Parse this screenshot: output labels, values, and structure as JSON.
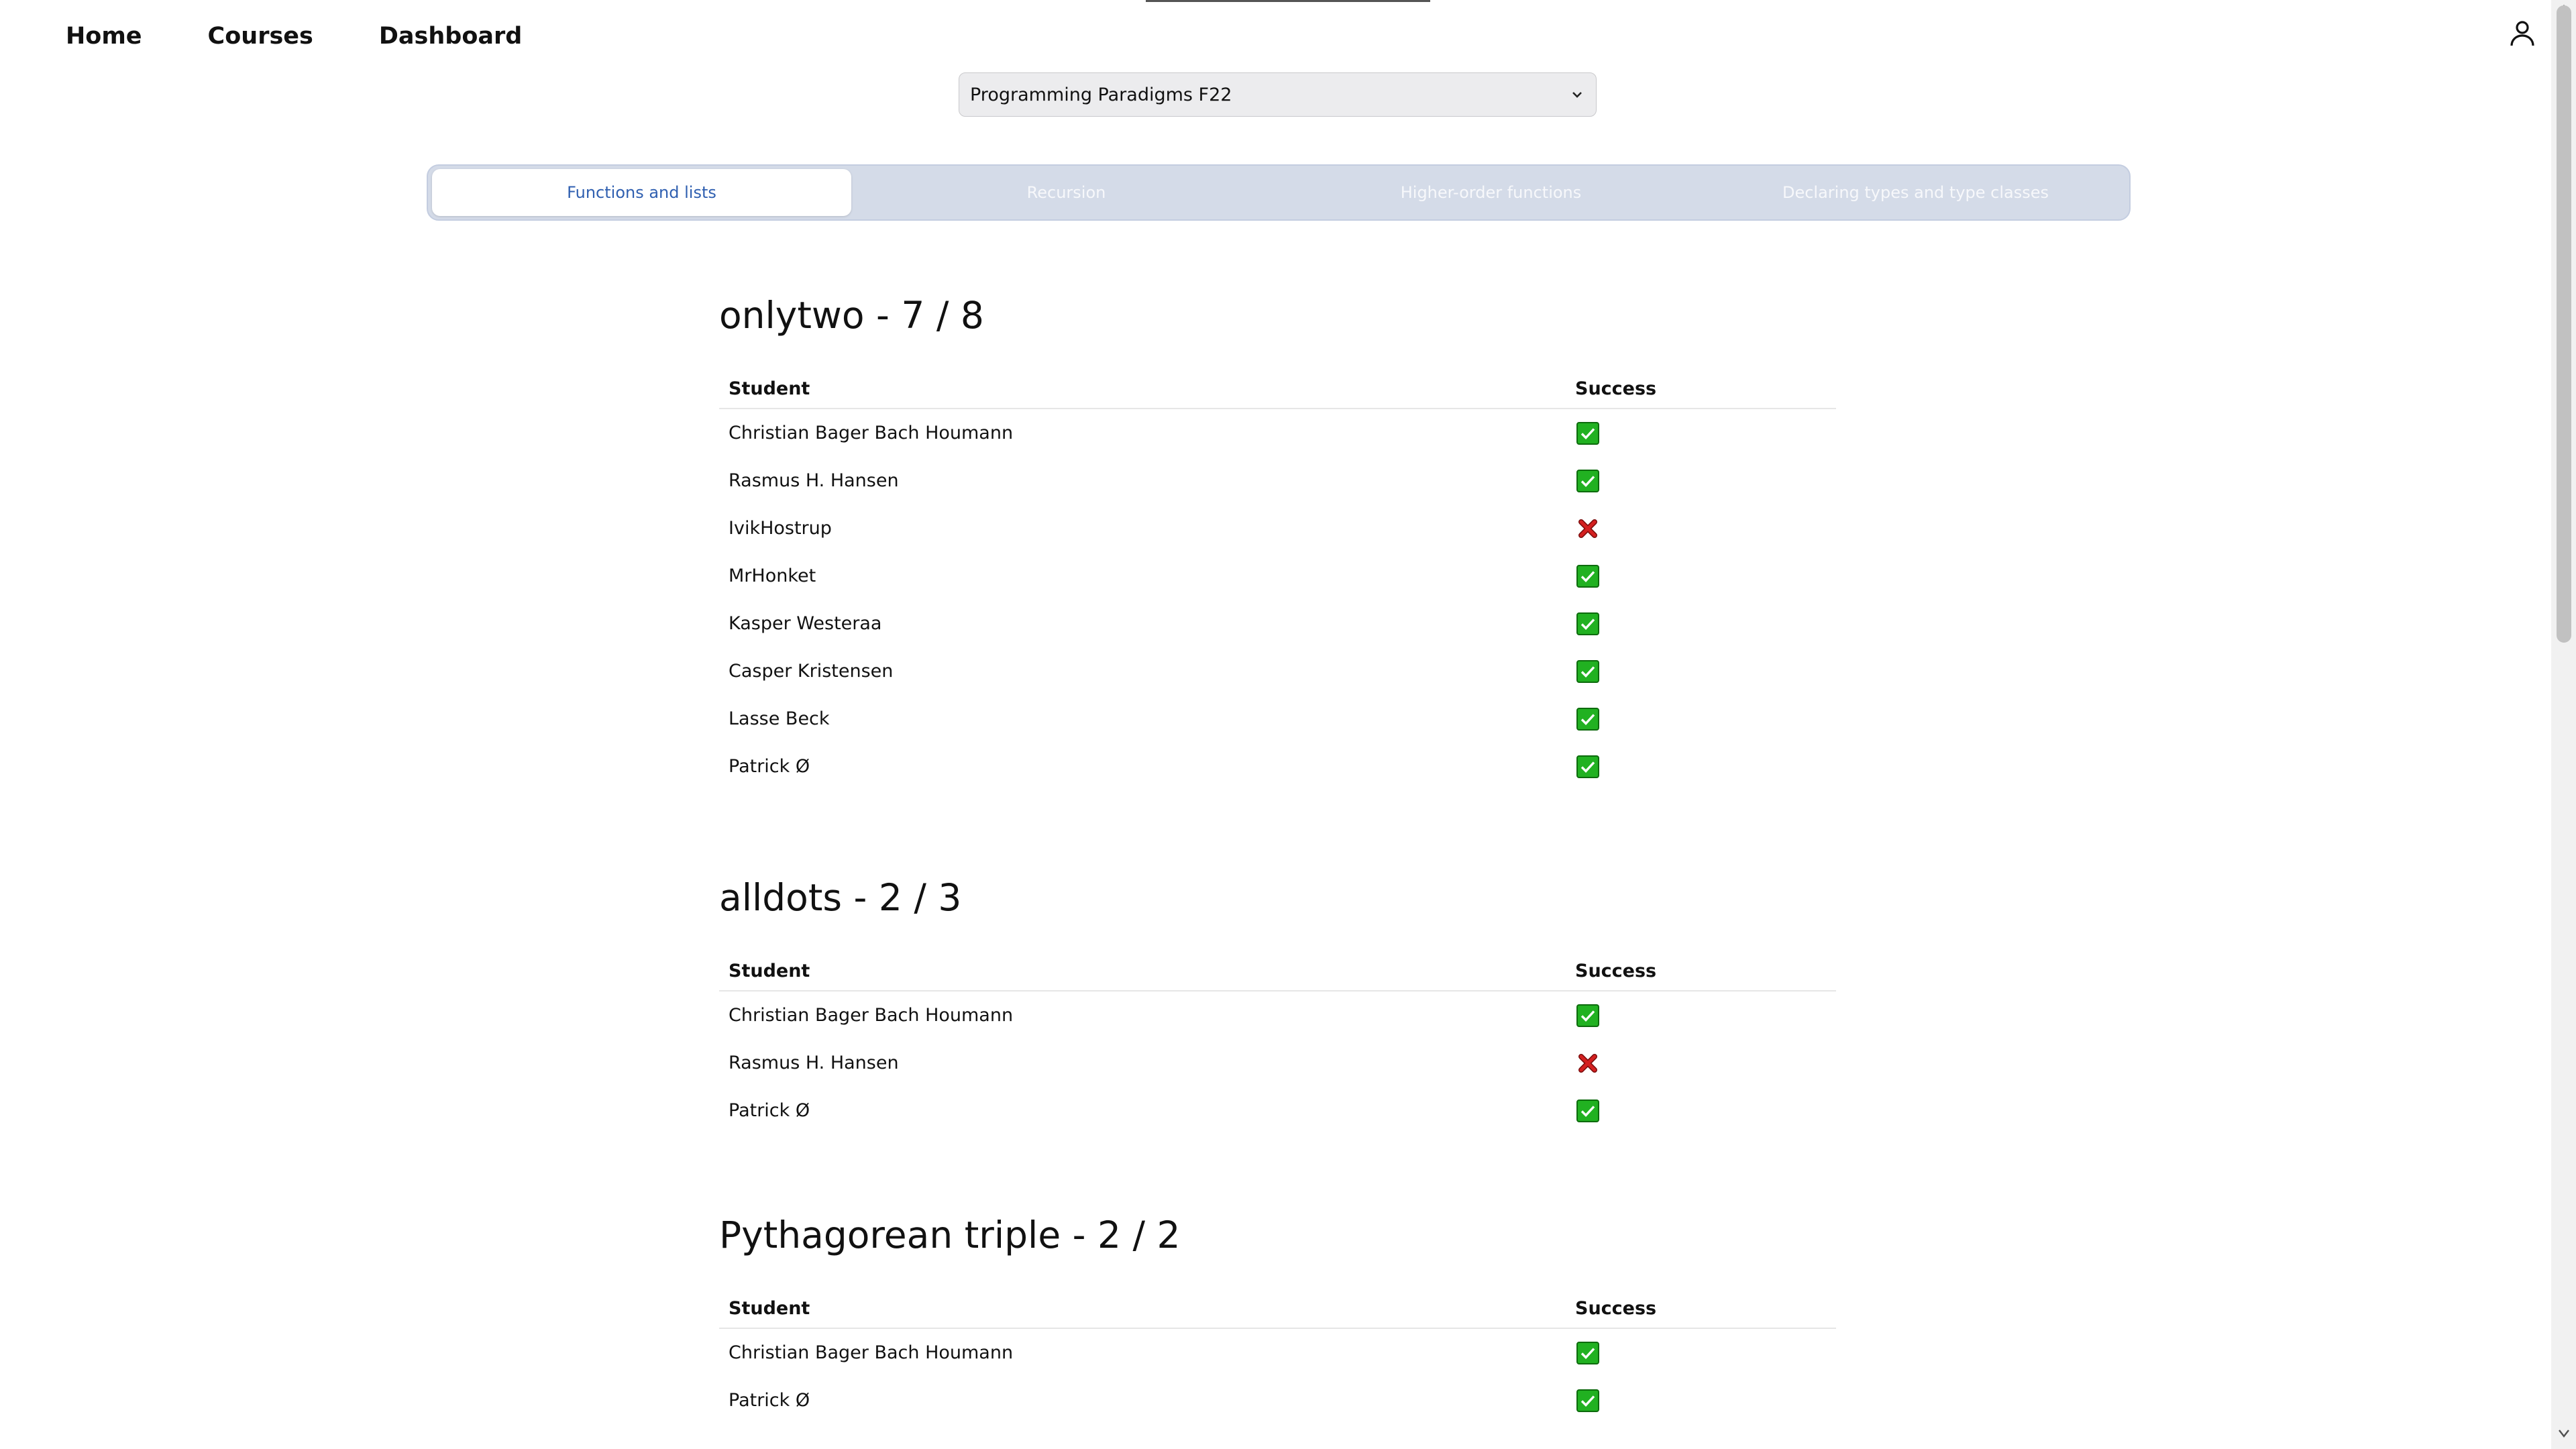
{
  "nav": {
    "home": "Home",
    "courses": "Courses",
    "dashboard": "Dashboard"
  },
  "icons": {
    "user": "user-icon",
    "success": "check-icon",
    "fail": "cross-icon"
  },
  "colors": {
    "success": "#21b121",
    "fail": "#d42020",
    "active_tab_text": "#2f5fb0",
    "tab_bar": "#d4dbe8"
  },
  "course_select": {
    "value": "Programming Paradigms F22"
  },
  "tabs": [
    {
      "label": "Functions and lists",
      "active": true
    },
    {
      "label": "Recursion",
      "active": false
    },
    {
      "label": "Higher-order functions",
      "active": false
    },
    {
      "label": "Declaring types and type classes",
      "active": false
    }
  ],
  "table_headers": {
    "student": "Student",
    "success": "Success"
  },
  "sections": [
    {
      "title": "onlytwo - 7 / 8",
      "rows": [
        {
          "student": "Christian Bager Bach Houmann",
          "success": true
        },
        {
          "student": "Rasmus H. Hansen",
          "success": true
        },
        {
          "student": "IvikHostrup",
          "success": false
        },
        {
          "student": "MrHonket",
          "success": true
        },
        {
          "student": "Kasper Westeraa",
          "success": true
        },
        {
          "student": "Casper Kristensen",
          "success": true
        },
        {
          "student": "Lasse Beck",
          "success": true
        },
        {
          "student": "Patrick Ø",
          "success": true
        }
      ]
    },
    {
      "title": "alldots - 2 / 3",
      "rows": [
        {
          "student": "Christian Bager Bach Houmann",
          "success": true
        },
        {
          "student": "Rasmus H. Hansen",
          "success": false
        },
        {
          "student": "Patrick Ø",
          "success": true
        }
      ]
    },
    {
      "title": "Pythagorean triple - 2 / 2",
      "rows": [
        {
          "student": "Christian Bager Bach Houmann",
          "success": true
        },
        {
          "student": "Patrick Ø",
          "success": true
        }
      ]
    }
  ]
}
